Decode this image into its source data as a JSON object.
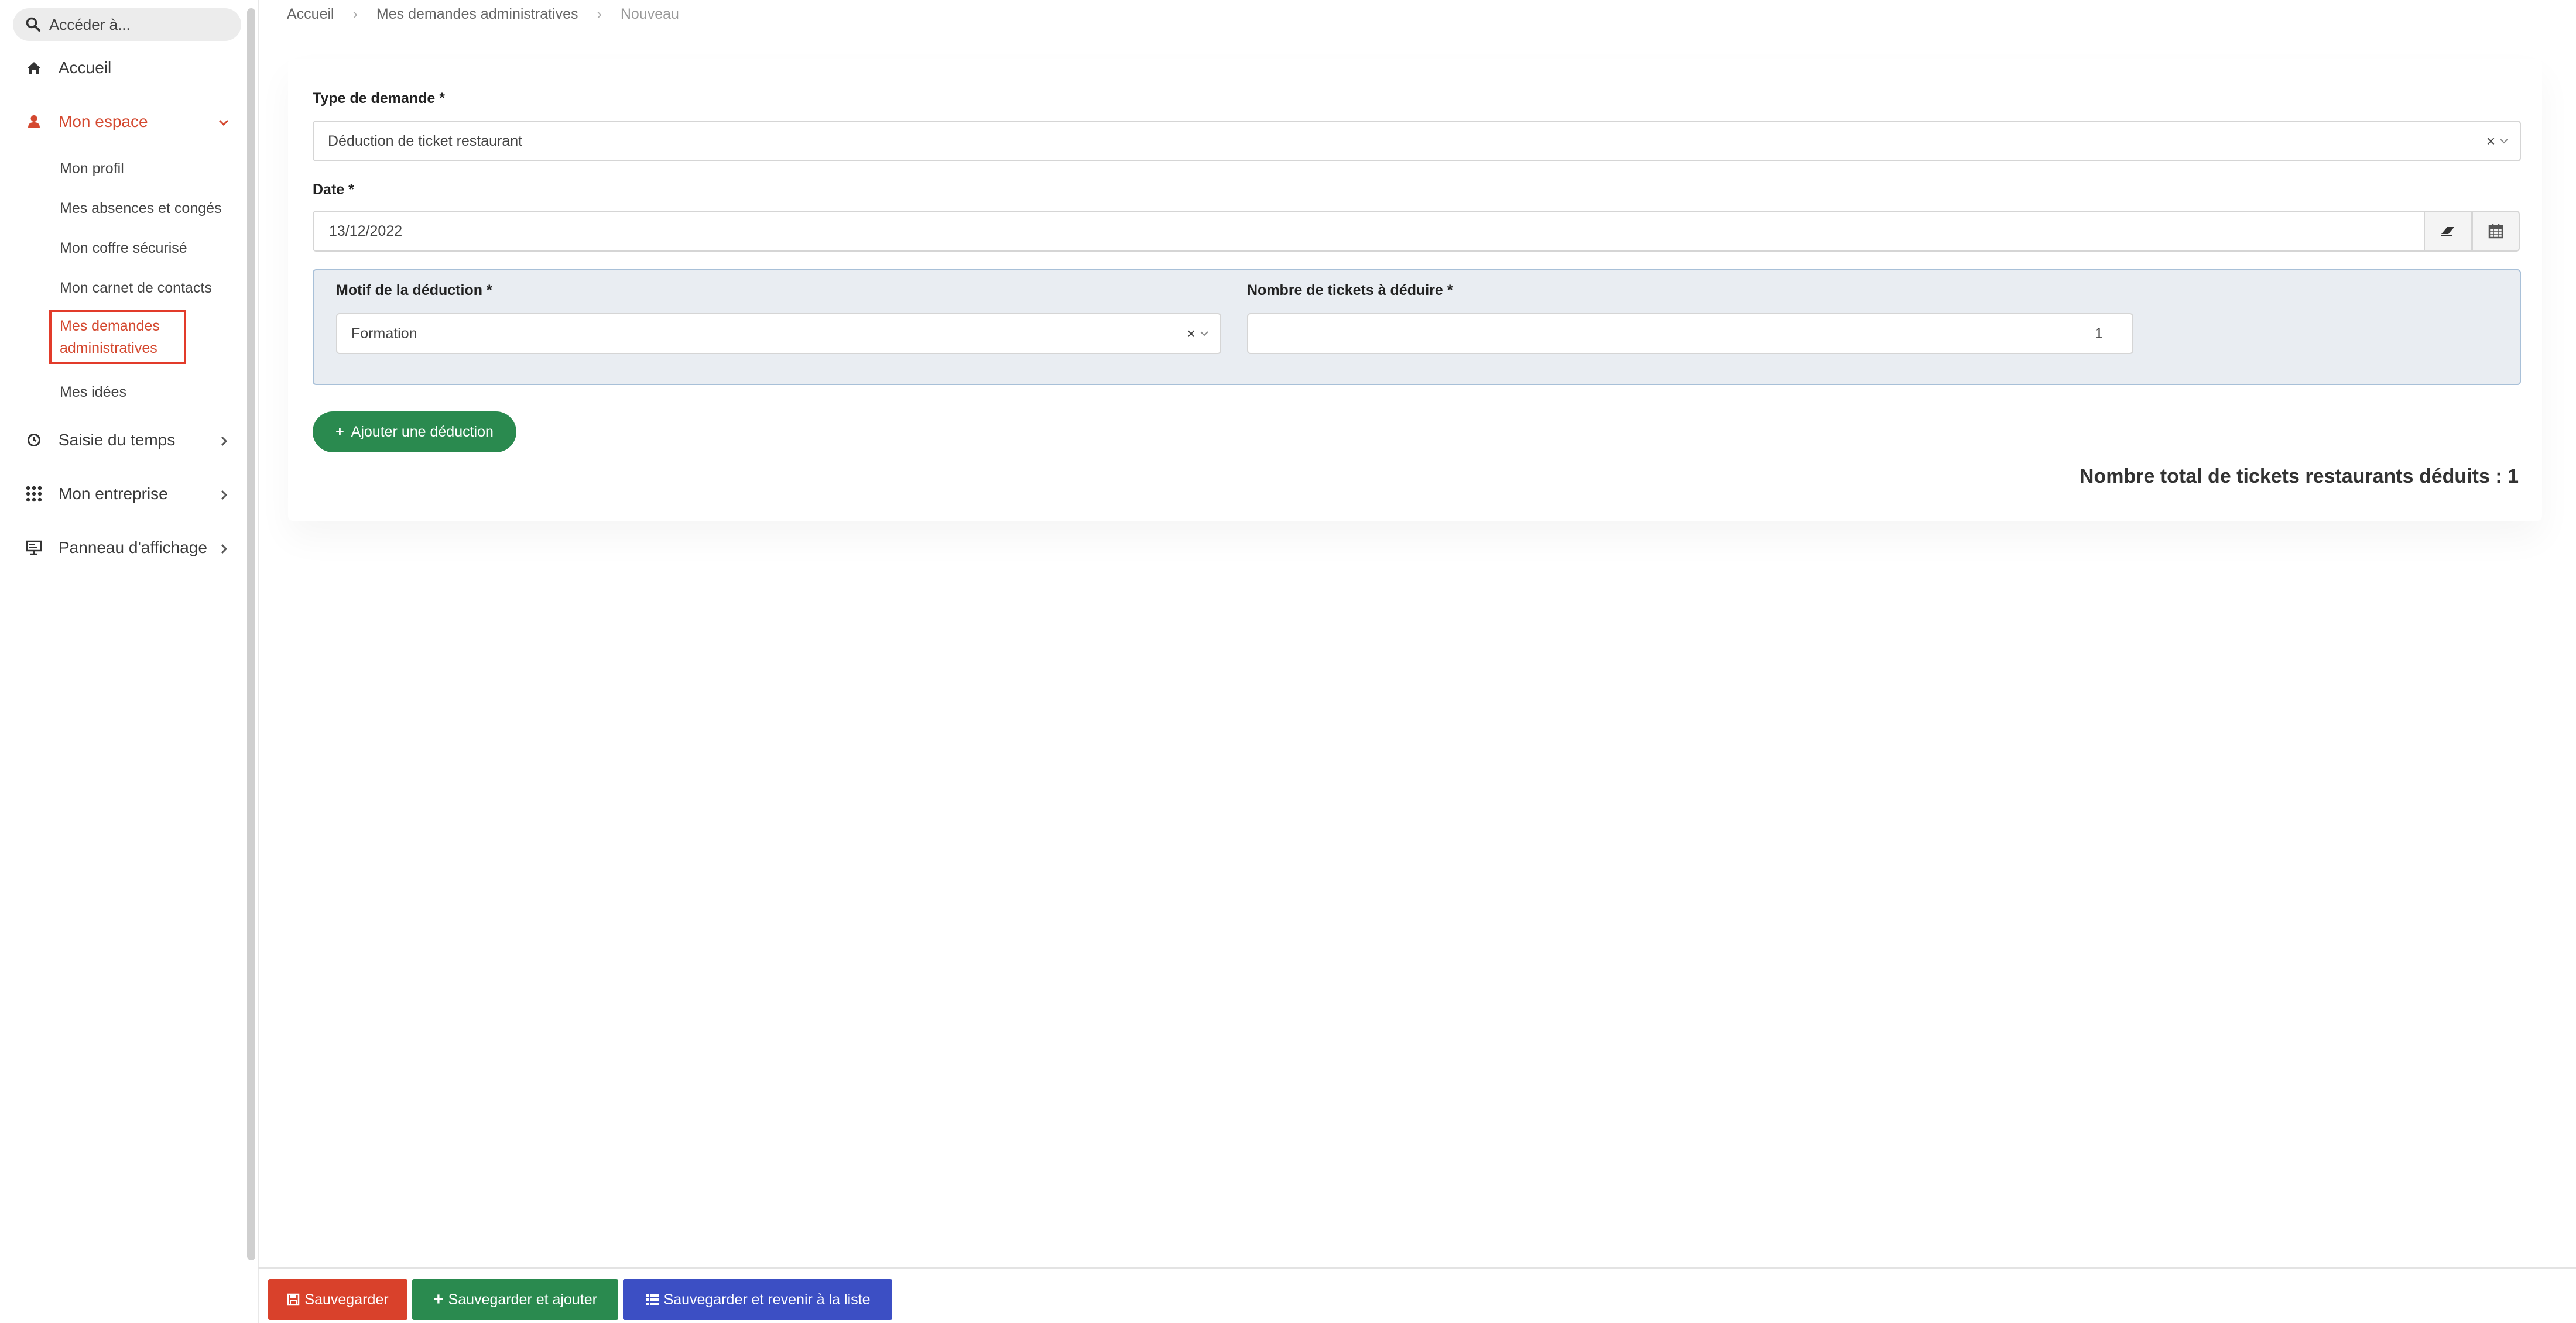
{
  "sidebar": {
    "search_placeholder": "Accéder à...",
    "items": [
      {
        "label": "Accueil",
        "icon": "home-icon"
      },
      {
        "label": "Mon espace",
        "icon": "user-icon",
        "active": true
      },
      {
        "label": "Saisie du temps",
        "icon": "clock-icon"
      },
      {
        "label": "Mon entreprise",
        "icon": "grid-icon"
      },
      {
        "label": "Panneau d'affichage",
        "icon": "display-board-icon"
      }
    ],
    "sub_items": [
      "Mon profil",
      "Mes absences et congés",
      "Mon coffre sécurisé",
      "Mon carnet de contacts",
      "Mes demandes administratives",
      "Mes idées"
    ]
  },
  "breadcrumb": {
    "home": "Accueil",
    "section": "Mes demandes administratives",
    "current": "Nouveau"
  },
  "form": {
    "type_label": "Type de demande *",
    "type_value": "Déduction de ticket restaurant",
    "date_label": "Date *",
    "date_value": "13/12/2022",
    "motif_label": "Motif de la déduction *",
    "motif_value": "Formation",
    "count_label": "Nombre de tickets à déduire *",
    "count_value": "1",
    "add_button": "Ajouter une déduction",
    "total_text": "Nombre total de tickets restaurants déduits : 1"
  },
  "footer": {
    "save": "Sauvegarder",
    "save_add": "Sauvegarder et ajouter",
    "save_back": "Sauvegarder et revenir à la liste"
  },
  "colors": {
    "accent_red": "#d4482f",
    "save_button": "#d9412b",
    "save_add_button": "#2a8a4f",
    "save_back_button": "#3c4fc4",
    "deduction_panel": "#e9edf2"
  }
}
